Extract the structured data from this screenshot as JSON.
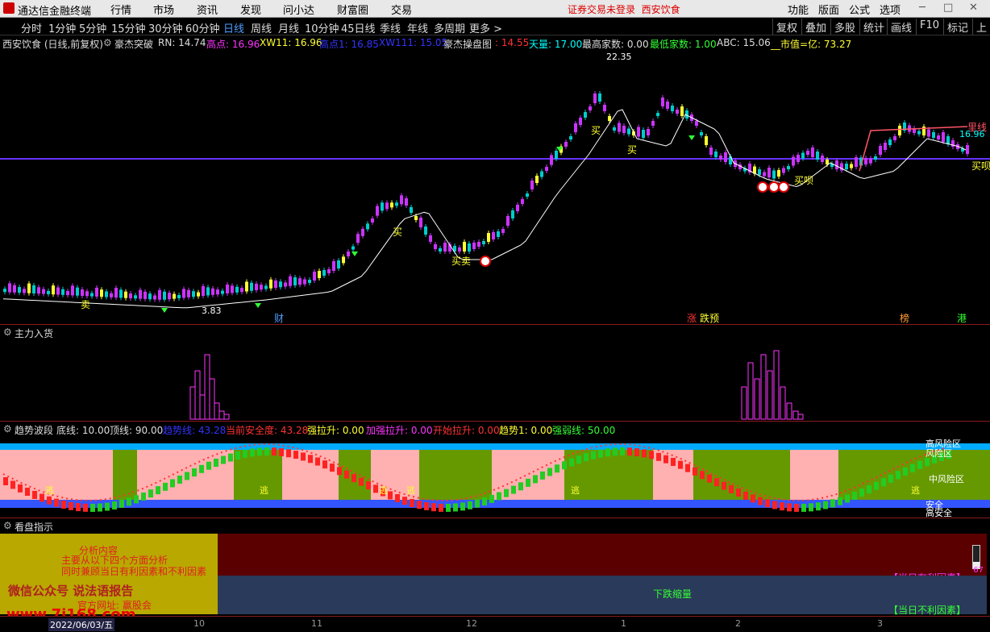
{
  "app": {
    "brand": "通达信金融终端",
    "menus": [
      "行情",
      "市场",
      "资讯",
      "发现",
      "问小达",
      "财富圈",
      "交易"
    ],
    "warning": "证券交易未登录",
    "stock_title": "西安饮食",
    "right_menus": [
      "功能",
      "版面",
      "公式",
      "选项"
    ]
  },
  "periods": [
    "分时",
    "1分钟",
    "5分钟",
    "15分钟",
    "30分钟",
    "60分钟",
    "日线",
    "周线",
    "月线",
    "10分钟",
    "45日线",
    "季线",
    "年线",
    "多周期",
    "更多 >"
  ],
  "active_period": "日线",
  "right_buttons": [
    "复权",
    "叠加",
    "多股",
    "统计",
    "画线",
    "F10",
    "标记",
    "上"
  ],
  "info": {
    "name": "西安饮食 (日线,前复权)",
    "indicator": "豪杰突破",
    "rn": "RN: 14.74",
    "high": "高点: 16.96",
    "xw": "XW11: 16.96",
    "high1": "高点1: 16.85",
    "xw111": "XW111: 15.05",
    "op": "豪杰操盘图",
    "v1": ": 14.55",
    "tian": "天量: 17.00",
    "maxh": "最高家数: 0.00",
    "minh": "最低家数: 1.00",
    "abc": "ABC: 15.06",
    "mcap": "__市值=亿: 73.27"
  },
  "chart_labels": {
    "peak": "22.35",
    "low": "3.83",
    "buy": "买",
    "sell": "卖",
    "buy_sell": "买卖",
    "buy_real": "买呗",
    "finance": "财",
    "zhang": "涨",
    "fall_warn": "跌预",
    "jie": "榜",
    "gang": "港",
    "red_line": "里线",
    "price_right": "16.96"
  },
  "panel2": {
    "title": "主力入货"
  },
  "panel3": {
    "title": "趋势波段",
    "bottom": "底线: 10.00",
    "top": "顶线: 90.00",
    "trend": "趋势线: 43.28",
    "safe": "当前安全度: 43.28",
    "strong": "强拉升: 0.00",
    "add": "加强拉升: 0.00",
    "start": "开始拉升: 0.00",
    "trend1": "趋势1: 0.00",
    "weak": "强弱线: 50.00",
    "zones": [
      "高风险区",
      "风险区",
      "中风险区",
      "安全",
      "高安全"
    ],
    "escape": "逃"
  },
  "panel4": {
    "title": "看盘指示",
    "left_text": [
      "分析内容",
      "主要从以下四个方面分析",
      "同时兼顾当日有利因素和不利因素",
      "微信公众号 说法语报告",
      "官方网址: 赢股会"
    ],
    "watermark": "www.7i168.com",
    "down": "下跌缩量",
    "good": "【当日有利因素】",
    "bad": "【当日不利因素】",
    "val": "67"
  },
  "time_axis": {
    "date": "2022/06/03/五",
    "ticks": [
      "10",
      "11",
      "12",
      "1",
      "2",
      "3"
    ]
  },
  "colors": {
    "up": "#ff3333",
    "down": "#00cccc",
    "bg": "#000000",
    "accent": "#4f9cff"
  }
}
